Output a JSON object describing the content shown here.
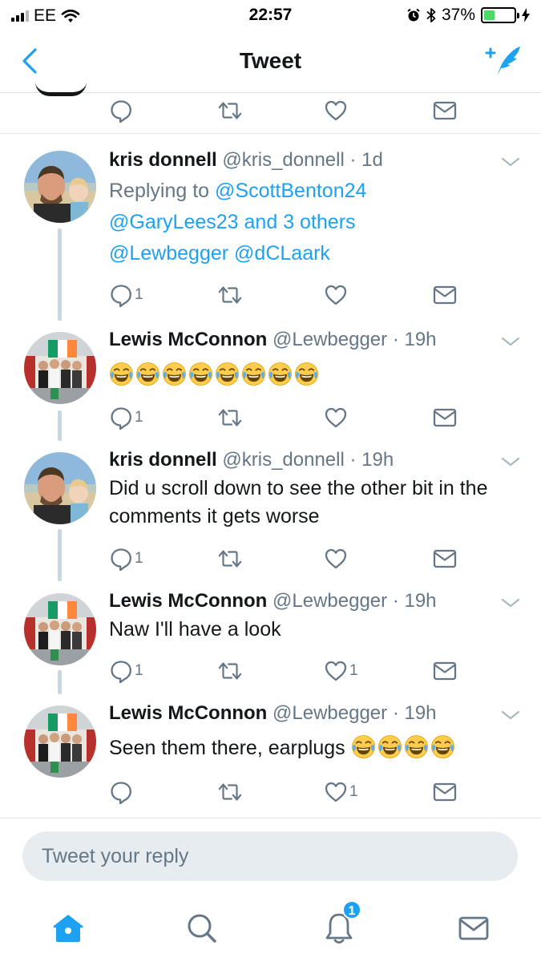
{
  "status_bar": {
    "carrier": "EE",
    "time": "22:57",
    "battery_percent": "37%",
    "battery_level": 0.37
  },
  "nav": {
    "title": "Tweet",
    "back_icon": "chevron-left-icon",
    "compose_icon": "compose-tweet-icon"
  },
  "tweets": [
    {
      "name": "kris donnell",
      "handle": "@kris_donnell",
      "time": "· 1d",
      "replying_prefix": "Replying to",
      "replying_mentions": [
        "@ScottBenton24",
        "@GaryLees23",
        "and 3 others"
      ],
      "replying_more": [
        "@Lewbegger",
        "@dCLaark"
      ],
      "replies": "1",
      "likes": ""
    },
    {
      "name": "Lewis McConnon",
      "handle": "@Lewbegger",
      "time": "· 19h",
      "text": "",
      "emoji_count": 8,
      "replies": "1",
      "likes": ""
    },
    {
      "name": "kris donnell",
      "handle": "@kris_donnell",
      "time": "· 19h",
      "text": "Did u scroll down to see the other bit in the comments it gets worse",
      "replies": "1",
      "likes": ""
    },
    {
      "name": "Lewis McConnon",
      "handle": "@Lewbegger",
      "time": "· 19h",
      "text": "Naw I'll have a look",
      "replies": "1",
      "likes": "1"
    },
    {
      "name": "Lewis McConnon",
      "handle": "@Lewbegger",
      "time": "· 19h",
      "text": "Seen them there, earplugs",
      "emoji_count": 4,
      "replies": "",
      "likes": "1"
    }
  ],
  "reply_box": {
    "placeholder": "Tweet your reply"
  },
  "tabs": [
    {
      "name": "home-icon"
    },
    {
      "name": "search-icon"
    },
    {
      "name": "notifications-icon",
      "badge": "1"
    },
    {
      "name": "messages-icon"
    }
  ],
  "colors": {
    "accent": "#1da1f2",
    "muted": "#657786",
    "divider": "#e1e8ed",
    "battery": "#4cd964"
  }
}
